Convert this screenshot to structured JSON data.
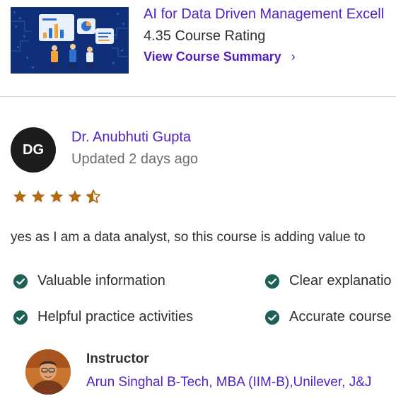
{
  "course": {
    "title": "AI for Data Driven Management Excell",
    "rating_text": "4.35 Course Rating",
    "summary_link": "View Course Summary",
    "summary_icon": "chevron-right-icon"
  },
  "review": {
    "avatar_initials": "DG",
    "reviewer_name": "Dr. Anubhuti Gupta",
    "updated": "Updated 2 days ago",
    "rating": 4.5,
    "star_color": "#b4690e",
    "text": "yes as I am a data analyst, so this course is adding value to"
  },
  "tags": {
    "check_color": "#1e6055",
    "items": [
      {
        "label": "Valuable information"
      },
      {
        "label": "Clear explanatio"
      },
      {
        "label": "Helpful practice activities"
      },
      {
        "label": "Accurate course"
      }
    ]
  },
  "instructor": {
    "heading": "Instructor",
    "name": "Arun Singhal B-Tech, MBA (IIM-B),Unilever, J&J"
  },
  "colors": {
    "accent": "#5022c3",
    "text": "#2d2f31",
    "muted": "#6a6f73",
    "divider": "#d1d7dc"
  }
}
